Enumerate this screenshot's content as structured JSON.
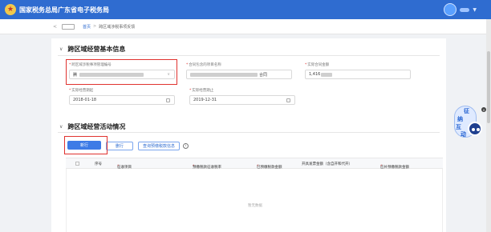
{
  "app": {
    "title": "国家税务总局广东省电子税务局"
  },
  "breadcrumb": {
    "back": "<",
    "home": "首页",
    "separator": ">",
    "current": "跨区域涉税事项反馈"
  },
  "section1": {
    "title": "跨区域经营基本信息",
    "fields": {
      "mgmt_no": {
        "label": "跨区域涉税事项管理编号",
        "value_prefix": "腾"
      },
      "contract_name": {
        "label": "合同包含的项目名称",
        "value_suffix": "合同"
      },
      "amount": {
        "label": "实际合同金额",
        "value": "1,416"
      },
      "start_date": {
        "label": "实际经营期起",
        "value": "2018-01-18"
      },
      "end_date": {
        "label": "实际经营期止",
        "value": "2019-12-31"
      }
    }
  },
  "section2": {
    "title": "跨区域经营活动情况",
    "buttons": {
      "add": "新行",
      "delete": "删行",
      "query": "查询预缴税款信息"
    },
    "info_icon": "i",
    "table": {
      "columns": [
        "序号",
        "征收项目",
        "预缴税款征收税率",
        "已预缴税款金额",
        "开具发票金额（含自开和代开）",
        "应补预缴税款金额"
      ],
      "empty_text": "暂无数据"
    }
  },
  "mascot": {
    "chars": [
      "征",
      "纳",
      "互",
      "动"
    ],
    "close": "×"
  },
  "icons": {
    "logo": "tax-emblem-icon",
    "avatar": "user-avatar-icon",
    "dropdown": "chevron-down-icon",
    "calendar": "calendar-icon",
    "collapse": "chevron-down-icon"
  },
  "colors": {
    "header": "#2f6cd0",
    "primary": "#3d7be6",
    "highlight": "#e0322f",
    "required": "#e0322f"
  }
}
